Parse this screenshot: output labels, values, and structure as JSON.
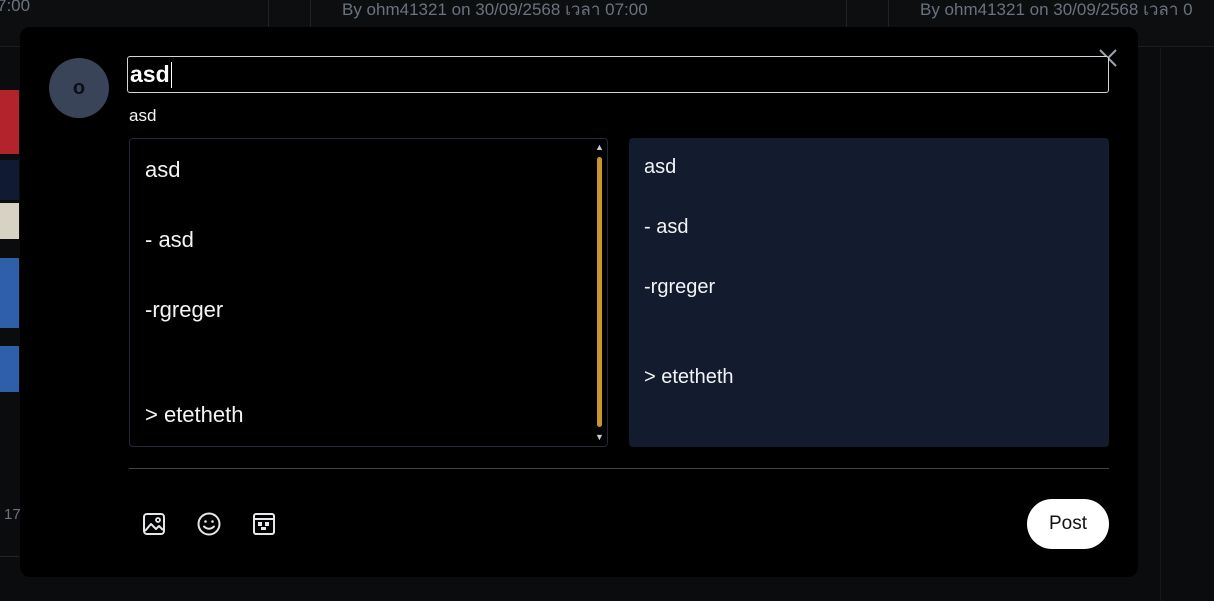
{
  "background": {
    "posts": [
      {
        "byline": "7:00"
      },
      {
        "byline": "By ohm41321 on 30/09/2568 เวลา 07:00"
      },
      {
        "byline": "By ohm41321 on 30/09/2568 เวลา 0"
      }
    ],
    "side_number": "17"
  },
  "composer": {
    "avatar_initial": "o",
    "title_value": "asd",
    "title_preview": "asd",
    "editor_lines": [
      "asd",
      "- asd",
      "-rgreger",
      "> etetheth"
    ],
    "preview_lines": [
      "asd",
      "- asd",
      "-rgreger",
      "> etetheth"
    ],
    "toolbar": {
      "image_icon": "image-icon",
      "emoji_icon": "emoji-icon",
      "gif_icon": "gif-icon"
    },
    "post_label": "Post"
  },
  "colors": {
    "modal_bg": "#000000",
    "preview_bg": "#131b2e",
    "scroll_thumb": "#c9962b",
    "avatar_bg": "#3a4459"
  }
}
